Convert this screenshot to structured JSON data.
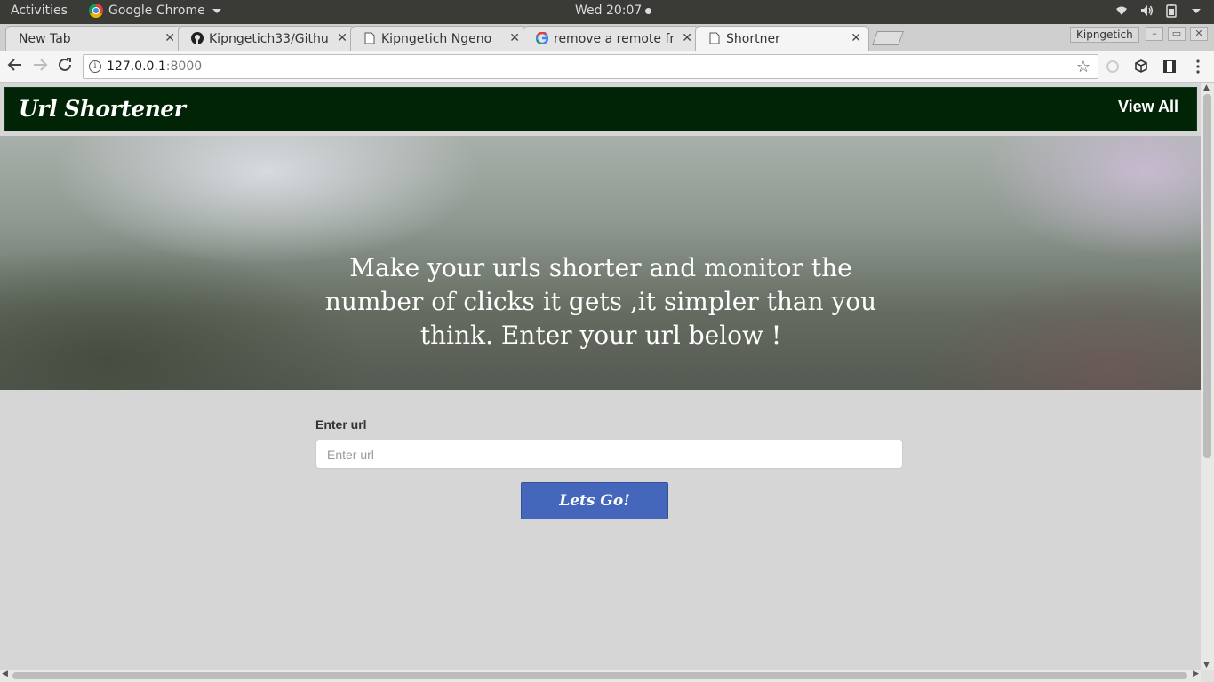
{
  "os_bar": {
    "activities": "Activities",
    "app_name": "Google Chrome",
    "clock": "Wed 20:07"
  },
  "tabs": [
    {
      "title": "New Tab",
      "icon": "none",
      "active": false
    },
    {
      "title": "Kipngetich33/Githu",
      "icon": "github-icon",
      "active": false
    },
    {
      "title": "Kipngetich Ngeno",
      "icon": "page-icon",
      "active": false
    },
    {
      "title": "remove a remote fr",
      "icon": "google-icon",
      "active": false
    },
    {
      "title": "Shortner",
      "icon": "page-icon",
      "active": true
    }
  ],
  "window": {
    "profile_name": "Kipngetich"
  },
  "omnibox": {
    "host": "127.0.0.1",
    "port": ":8000"
  },
  "site": {
    "brand": "Url Shortener",
    "nav_link": "View All",
    "hero_text": "Make your urls shorter and monitor the number of clicks it gets ,it simpler than you think. Enter your url below !",
    "form_label": "Enter url",
    "input_value": "",
    "input_placeholder": "Enter url",
    "submit_label": "Lets Go!"
  },
  "colors": {
    "navbar_bg": "#002405",
    "page_bg": "#d6d6d6",
    "button_bg": "#4567bb"
  }
}
